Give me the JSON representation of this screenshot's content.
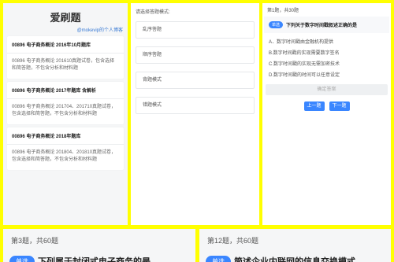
{
  "bank_list": {
    "title": "爱刷题",
    "subtitle": "@mokevip的个人博客",
    "banks": [
      {
        "title": "00896 电子商务概论 2016年10月题库",
        "desc": "00896 电子商务概论 201610真题试卷，包含选择和简答题，不包含分析和材料题"
      },
      {
        "title": "00896 电子商务概论 2017年题库 含解析",
        "desc": "00896 电子商务概论 201704、201710真题试卷，包含选择和简答题，不包含分析和材料题"
      },
      {
        "title": "00896 电子商务概论 2018年题库",
        "desc": "00896 电子商务概论 201804、201810真题试卷，包含选择和简答题，不包含分析和材料题"
      }
    ]
  },
  "mode_select": {
    "prompt": "请选择答题模式:",
    "modes": [
      "乱序答题",
      "顺序答题",
      "背题模式",
      "错题模式"
    ]
  },
  "question_view": {
    "progress": "第1题，共30题",
    "badge": "单选",
    "question": "下列关于数字时间戳叙述正确的是",
    "options": [
      "A．数字时间戳由金融机构提供",
      "B.数字时间戳的实现需要数字签名",
      "C.数字时间戳的实现无需加密技术",
      "D.数字时间戳的时间可以任意设定"
    ],
    "confirm_label": "确定答案",
    "prev_label": "上一题",
    "next_label": "下一题"
  },
  "bottom_left": {
    "progress": "第3题，共60题",
    "badge": "单选",
    "question": "下列属于封闭式电子商务的是"
  },
  "bottom_right": {
    "progress": "第12题，共60题",
    "badge": "单选",
    "question": "简述企业内联网的信息交换模式"
  },
  "colors": {
    "accent": "#3a86ff",
    "frame": "#ffff00"
  }
}
